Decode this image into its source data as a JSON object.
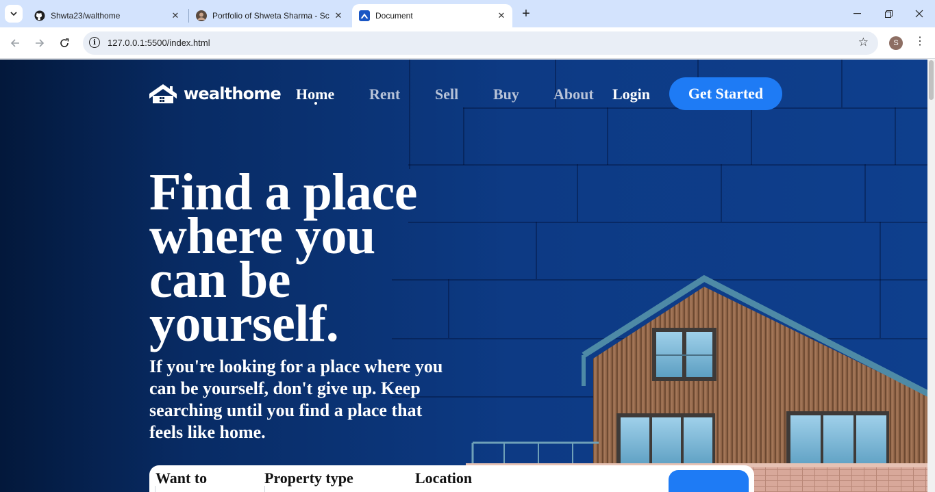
{
  "browser": {
    "tabs": [
      {
        "title": "Shwta23/walthome",
        "icon": "github-icon"
      },
      {
        "title": "Portfolio of Shweta Sharma - Sc",
        "icon": "profile-photo-icon"
      },
      {
        "title": "Document",
        "icon": "wealthome-house-icon",
        "active": true
      }
    ],
    "url": "127.0.0.1:5500/index.html",
    "profile_initial": "S"
  },
  "site": {
    "brand": "wealthome",
    "nav": {
      "home": "Home",
      "rent": "Rent",
      "sell": "Sell",
      "buy": "Buy",
      "about": "About",
      "login": "Login",
      "cta": "Get Started"
    },
    "hero": {
      "title": "Find a place where you can be yourself.",
      "subtitle": "If you're looking for a place where you can be yourself, don't give up. Keep searching until you find a place that feels like home."
    },
    "search": {
      "want_to": "Want to",
      "property_type": "Property type",
      "location": "Location"
    }
  },
  "colors": {
    "accent": "#1e7bf5",
    "background_dark": "#03183b",
    "background_blue": "#0e3f8d"
  }
}
